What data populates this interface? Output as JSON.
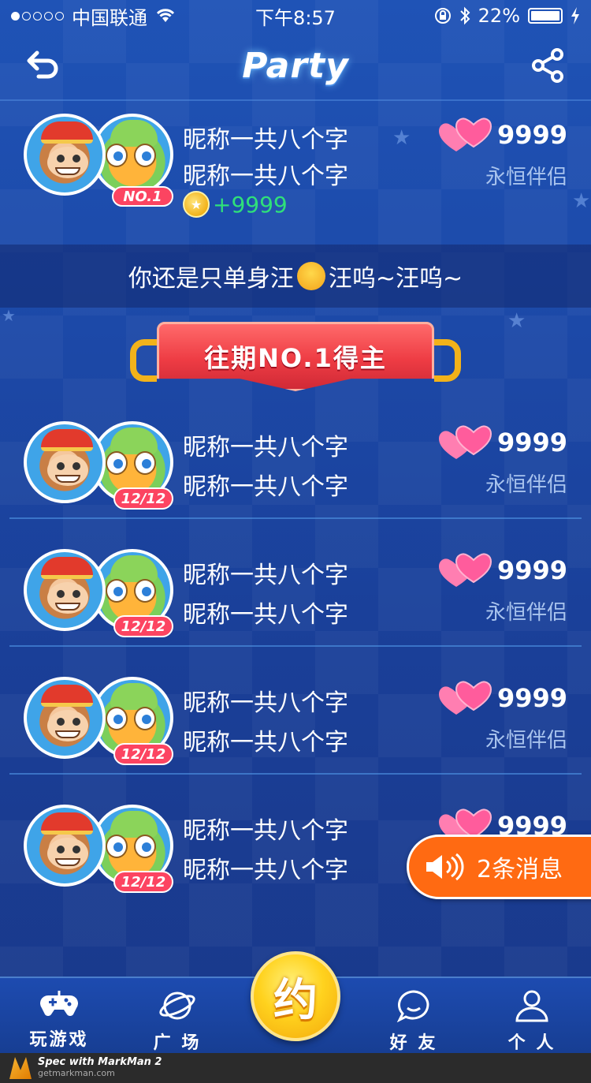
{
  "status_bar": {
    "carrier": "中国联通",
    "time": "下午8:57",
    "battery": "22%"
  },
  "nav": {
    "title": "Party"
  },
  "top_winner": {
    "nickname_1": "昵称一共八个字",
    "nickname_2": "昵称一共八个字",
    "rank": "NO.1",
    "score": "9999",
    "relation": "永恒伴侣",
    "coins": "+9999"
  },
  "tip": {
    "text_before": "你还是只单身汪",
    "text_after": "汪呜~汪呜~"
  },
  "ribbon": {
    "title": "往期NO.1得主"
  },
  "rows": [
    {
      "nickname_1": "昵称一共八个字",
      "nickname_2": "昵称一共八个字",
      "badge": "12/12",
      "score": "9999",
      "relation": "永恒伴侣"
    },
    {
      "nickname_1": "昵称一共八个字",
      "nickname_2": "昵称一共八个字",
      "badge": "12/12",
      "score": "9999",
      "relation": "永恒伴侣"
    },
    {
      "nickname_1": "昵称一共八个字",
      "nickname_2": "昵称一共八个字",
      "badge": "12/12",
      "score": "9999",
      "relation": "永恒伴侣"
    },
    {
      "nickname_1": "昵称一共八个字",
      "nickname_2": "昵称一共八个字",
      "badge": "12/12",
      "score": "9999",
      "relation": ""
    }
  ],
  "message_toast": {
    "text": "2条消息"
  },
  "tabs": [
    {
      "label": "玩游戏",
      "icon": "gamepad-icon"
    },
    {
      "label": "广 场",
      "icon": "planet-icon"
    },
    {
      "label": "约",
      "icon": "center-coin"
    },
    {
      "label": "好 友",
      "icon": "chat-bubble-icon"
    },
    {
      "label": "个 人",
      "icon": "person-icon"
    }
  ],
  "footer": {
    "brand": "Spec with MarkMan 2",
    "site": "getmarkman.com"
  },
  "colors": {
    "accent_red": "#fc4461",
    "coin_green": "#2fe07a",
    "toast_orange": "#ff6a12",
    "relation_text": "#a9c4ee"
  }
}
